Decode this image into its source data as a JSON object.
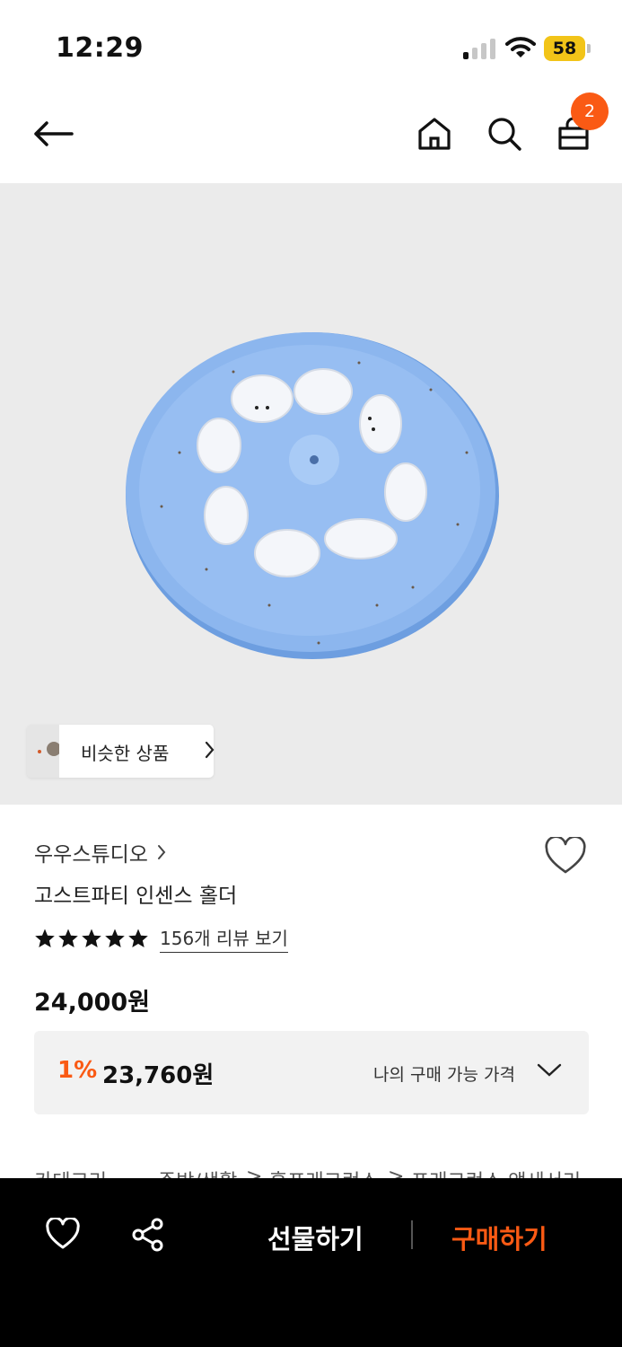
{
  "status_bar": {
    "time": "12:29",
    "battery": "58"
  },
  "nav": {
    "cart_count": "2"
  },
  "hero": {
    "similar_label": "비슷한 상품"
  },
  "product": {
    "brand": "우우스튜디오",
    "title": "고스트파티 인센스 홀더",
    "review_link": "156개 리뷰 보기",
    "rating_stars": 5,
    "price": "24,000원"
  },
  "my_price": {
    "discount": "1%",
    "price": "23,760원",
    "label": "나의 구매 가능 가격"
  },
  "category": {
    "label": "카테고리",
    "items": [
      "주방/생활",
      "홈프래그런스",
      "프래그런스 액세서리"
    ]
  },
  "bottom_bar": {
    "gift_label": "선물하기",
    "buy_label": "구매하기"
  },
  "colors": {
    "accent": "#fa5a14",
    "battery": "#f2c418",
    "hero_bg": "#ebebeb"
  }
}
